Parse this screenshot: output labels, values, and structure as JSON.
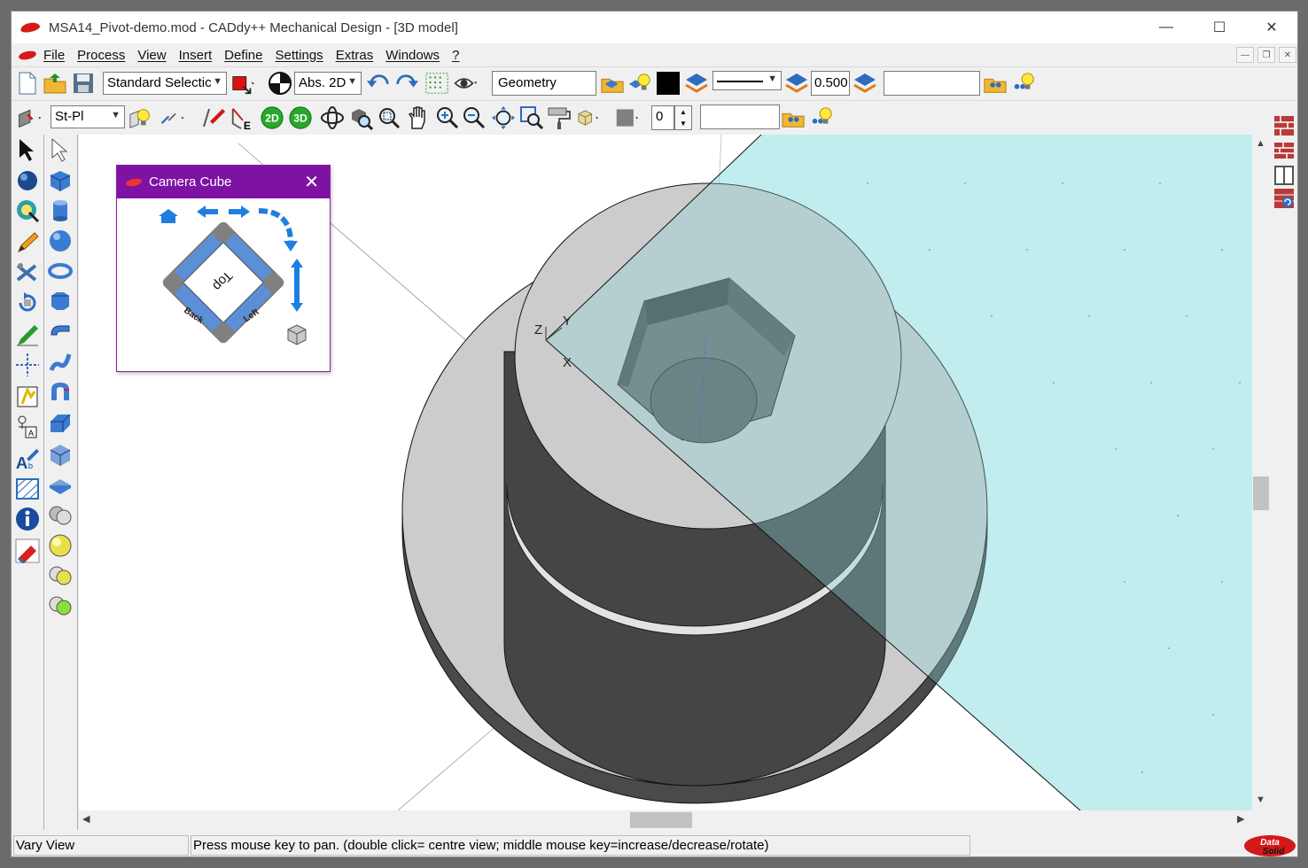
{
  "window": {
    "title": "MSA14_Pivot-demo.mod  -  CADdy++ Mechanical Design - [3D model]",
    "min": "—",
    "max": "☐",
    "close": "✕"
  },
  "menu": [
    "File",
    "Process",
    "View",
    "Insert",
    "Define",
    "Settings",
    "Extras",
    "Windows",
    "?"
  ],
  "toolbar1": {
    "selection_mode": "Standard Selectic",
    "coord_mode": "Abs. 2D",
    "layer_name": "Geometry",
    "line_width": "0.500",
    "name_field": ""
  },
  "toolbar2": {
    "plane": "St-Pl",
    "btn_2d": "2D",
    "btn_3d": "3D",
    "counter": "0",
    "field": ""
  },
  "camera_cube": {
    "title": "Camera Cube",
    "close": "✕",
    "face_top": "Top",
    "face_back": "Back",
    "face_left": "Left"
  },
  "axes": {
    "z": "Z",
    "y": "Y",
    "x": "X"
  },
  "status": {
    "mode": "Vary View",
    "hint": "Press mouse key to pan. (double click= centre view; middle mouse key=increase/decrease/rotate)",
    "brand1": "Data",
    "brand2": "Solid"
  },
  "colors": {
    "titlebar_purple": "#7e12a3",
    "plane_cyan": "#dffafb",
    "solid_light": "#cccccc",
    "solid_dark": "#4a4a4a",
    "accent_blue": "#1e7fe0"
  }
}
